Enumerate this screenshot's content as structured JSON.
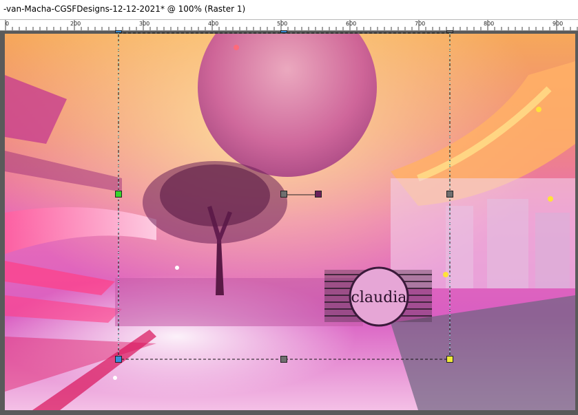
{
  "window": {
    "title": "-van-Macha-CGSFDesigns-12-12-2021* @ 100% (Raster 1)"
  },
  "ruler": {
    "labels": [
      "0",
      "200",
      "300",
      "400",
      "500",
      "600",
      "700",
      "800",
      "900"
    ]
  },
  "canvas": {
    "watermark_text": "claudia"
  },
  "colors": {
    "ruler_bg": "#ffffff",
    "canvas_border": "#5a5a5a",
    "handle_green": "#36d62c",
    "handle_gray": "#6f6f6f",
    "handle_blue": "#3a8fd8",
    "handle_yellow": "#f0ea3a",
    "handle_purple": "#6a1f5a"
  }
}
